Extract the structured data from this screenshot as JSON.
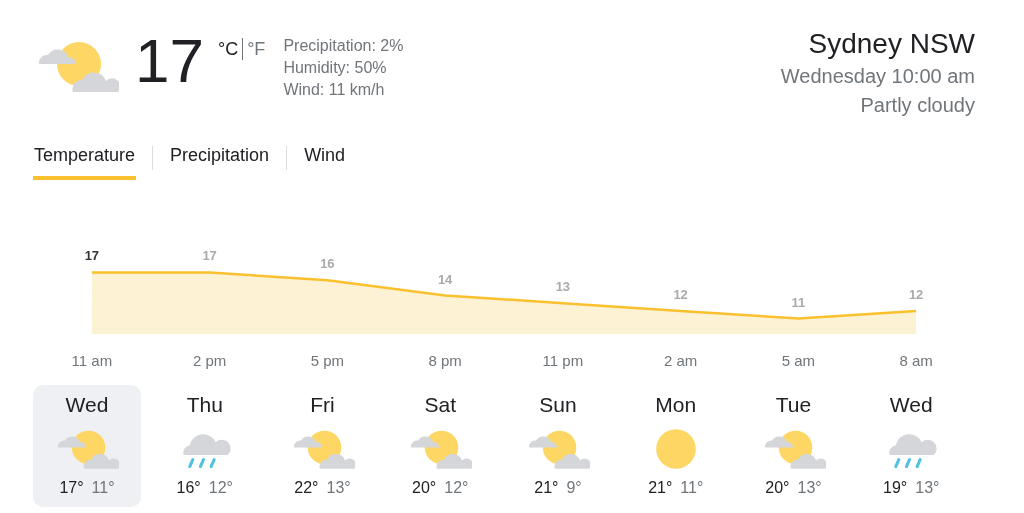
{
  "current": {
    "kind": "partly_cloudy",
    "temperature": "17",
    "units": [
      {
        "label": "°C",
        "selected": true
      },
      {
        "label": "°F",
        "selected": false
      }
    ],
    "details": [
      "Precipitation: 2%",
      "Humidity: 50%",
      "Wind: 11 km/h"
    ]
  },
  "location": {
    "name": "Sydney NSW",
    "time": "Wednesday 10:00 am",
    "condition": "Partly cloudy"
  },
  "tabs": [
    {
      "label": "Temperature",
      "selected": true
    },
    {
      "label": "Precipitation",
      "selected": false
    },
    {
      "label": "Wind",
      "selected": false
    }
  ],
  "chart": {
    "chart_data": {
      "type": "area",
      "categories": [
        "11 am",
        "2 pm",
        "5 pm",
        "8 pm",
        "11 pm",
        "2 am",
        "5 am",
        "8 am"
      ],
      "series": [
        {
          "color": "#fbc02d",
          "values": [
            17,
            17,
            16,
            14,
            13,
            12,
            11,
            12
          ]
        }
      ],
      "data_labels": true
    }
  },
  "days": [
    {
      "day": "Wed",
      "kind": "partly_cloudy",
      "high": "17°",
      "low": "11°",
      "selected": true
    },
    {
      "day": "Thu",
      "kind": "rain",
      "high": "16°",
      "low": "12°",
      "selected": false
    },
    {
      "day": "Fri",
      "kind": "partly_cloudy",
      "high": "22°",
      "low": "13°",
      "selected": false
    },
    {
      "day": "Sat",
      "kind": "partly_cloudy",
      "high": "20°",
      "low": "12°",
      "selected": false
    },
    {
      "day": "Sun",
      "kind": "partly_cloudy",
      "high": "21°",
      "low": "9°",
      "selected": false
    },
    {
      "day": "Mon",
      "kind": "sunny",
      "high": "21°",
      "low": "11°",
      "selected": false
    },
    {
      "day": "Tue",
      "kind": "partly_cloudy",
      "high": "20°",
      "low": "13°",
      "selected": false
    },
    {
      "day": "Wed",
      "kind": "rain",
      "high": "19°",
      "low": "13°",
      "selected": false
    }
  ]
}
